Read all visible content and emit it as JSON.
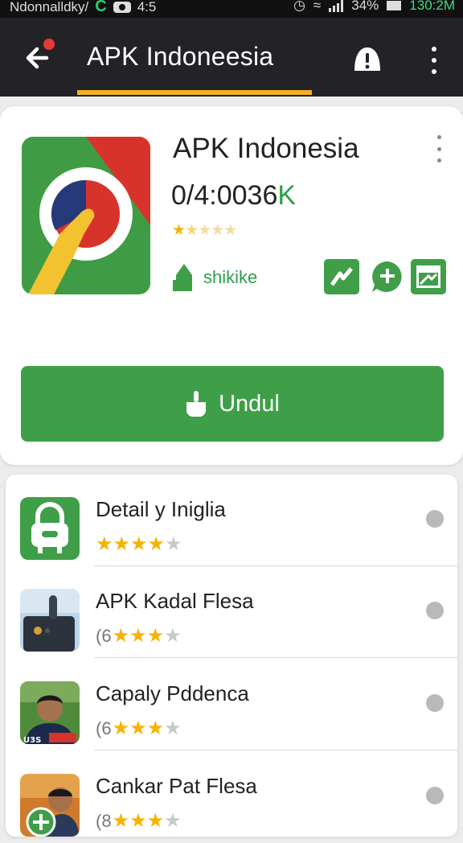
{
  "statusbar": {
    "carrier": "Ndonnalldky/",
    "notif_time": "4:5",
    "battery": "34%",
    "clock": "130:2M"
  },
  "appbar": {
    "title": "APK Indoneesia"
  },
  "app": {
    "name": "APK Indonesia",
    "version_main": "0/4:0036",
    "version_suffix": "K",
    "rating_stars": 1.5,
    "developer": "shikike",
    "download_label": "Undul"
  },
  "list": [
    {
      "title": "Detail y Iniglia",
      "count": "",
      "stars": 4,
      "icon": "lock-robot-icon"
    },
    {
      "title": "APK Kadal Flesa",
      "count": "(6",
      "stars": 3,
      "icon": "device-photo-icon"
    },
    {
      "title": "Capaly Pddenca",
      "count": "(6",
      "stars": 3,
      "icon": "person-photo-icon"
    },
    {
      "title": "Cankar Pat Flesa",
      "count": "(8",
      "stars": 3,
      "icon": "person-add-photo-icon"
    }
  ],
  "list_photo_label": "U3S",
  "colors": {
    "appbar": "#222227",
    "accent_green": "#3f9f48",
    "underline": "#f2b01e",
    "star": "#f5b301"
  }
}
